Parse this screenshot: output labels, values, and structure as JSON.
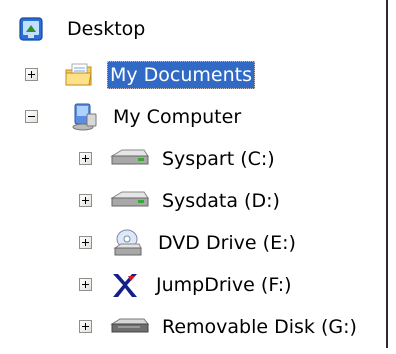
{
  "tree": {
    "root": {
      "label": "Desktop",
      "icon": "desktop-icon"
    },
    "items": [
      {
        "label": "My Documents",
        "icon": "my-documents-folder-icon",
        "expander": "plus",
        "selected": true
      },
      {
        "label": "My Computer",
        "icon": "my-computer-icon",
        "expander": "minus",
        "selected": false
      },
      {
        "label": "Syspart (C:)",
        "icon": "hard-drive-icon",
        "expander": "plus",
        "selected": false
      },
      {
        "label": "Sysdata (D:)",
        "icon": "hard-drive-icon",
        "expander": "plus",
        "selected": false
      },
      {
        "label": "DVD Drive (E:)",
        "icon": "dvd-drive-icon",
        "expander": "plus",
        "selected": false
      },
      {
        "label": "JumpDrive (F:)",
        "icon": "jumpdrive-icon",
        "expander": "plus",
        "selected": false
      },
      {
        "label": "Removable Disk (G:)",
        "icon": "removable-disk-icon",
        "expander": "plus",
        "selected": false
      }
    ]
  },
  "colors": {
    "selection": "#316ac5",
    "selection_text": "#ffffff",
    "frame": "#2b2b2b"
  }
}
